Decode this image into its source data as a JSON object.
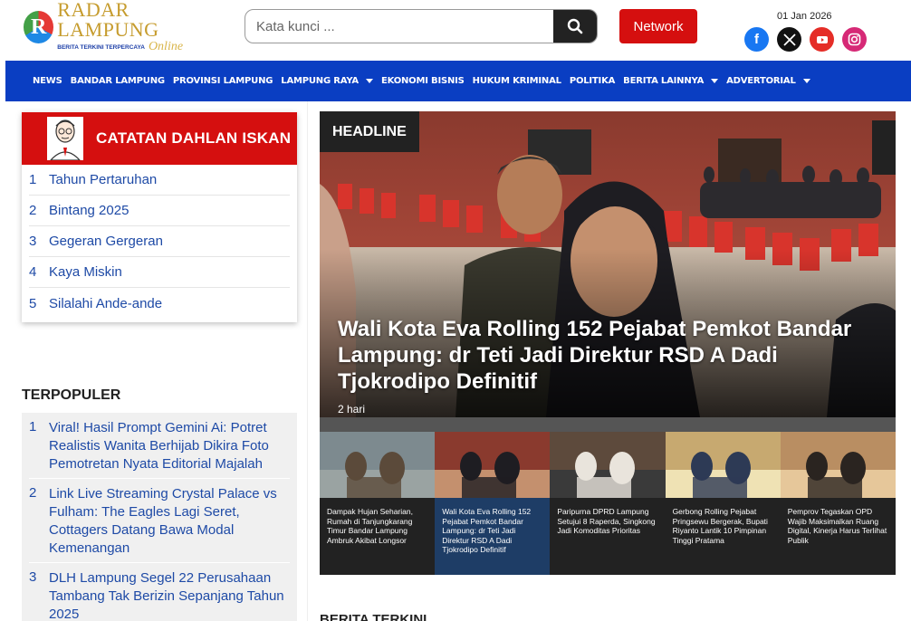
{
  "header": {
    "logo_letter": "R",
    "logo_title": "RADAR LAMPUNG",
    "logo_tagline": "BERITA TERKINI TERPERCAYA",
    "logo_online": "Online",
    "search_placeholder": "Kata kunci ...",
    "network_label": "Network",
    "date": "01 Jan 2026",
    "socials": [
      "facebook-icon",
      "x-icon",
      "youtube-icon",
      "instagram-icon"
    ]
  },
  "nav": {
    "items": [
      {
        "label": "NEWS",
        "dropdown": false
      },
      {
        "label": "BANDAR LAMPUNG",
        "dropdown": false
      },
      {
        "label": "PROVINSI LAMPUNG",
        "dropdown": false
      },
      {
        "label": "LAMPUNG RAYA",
        "dropdown": true
      },
      {
        "label": "EKONOMI BISNIS",
        "dropdown": false
      },
      {
        "label": "HUKUM KRIMINAL",
        "dropdown": false
      },
      {
        "label": "POLITIKA",
        "dropdown": false
      },
      {
        "label": "BERITA LAINNYA",
        "dropdown": true
      },
      {
        "label": "ADVERTORIAL",
        "dropdown": true
      }
    ]
  },
  "dahlan": {
    "title": "CATATAN DAHLAN ISKAN",
    "items": [
      {
        "num": "1",
        "label": "Tahun Pertaruhan"
      },
      {
        "num": "2",
        "label": "Bintang 2025"
      },
      {
        "num": "3",
        "label": "Gegeran Gergeran"
      },
      {
        "num": "4",
        "label": "Kaya Miskin"
      },
      {
        "num": "5",
        "label": "Silalahi Ande-ande"
      }
    ]
  },
  "terpopuler": {
    "title": "TERPOPULER",
    "items": [
      {
        "num": "1",
        "label": "Viral! Hasil Prompt Gemini Ai: Potret Realistis Wanita Berhijab Dikira Foto Pemotretan Nyata Editorial Majalah"
      },
      {
        "num": "2",
        "label": "Link Live Streaming Crystal Palace vs Fulham: The Eagles Lagi Seret, Cottagers Datang Bawa Modal Kemenangan"
      },
      {
        "num": "3",
        "label": "DLH Lampung Segel 22 Perusahaan Tambang Tak Berizin Sepanjang Tahun 2025"
      }
    ]
  },
  "headline": {
    "badge": "HEADLINE",
    "title": "Wali Kota Eva Rolling 152 Pejabat Pemkot Bandar Lampung: dr Teti Jadi Direktur RSD A Dadi Tjokrodipo Definitif",
    "time": "2 hari"
  },
  "thumbs": [
    {
      "caption": "Dampak Hujan Seharian, Rumah di Tanjungkarang Timur Bandar Lampung Ambruk Akibat Longsor",
      "active": false
    },
    {
      "caption": "Wali Kota Eva Rolling 152 Pejabat Pemkot Bandar Lampung: dr Teti Jadi Direktur RSD A Dadi Tjokrodipo Definitif",
      "active": true
    },
    {
      "caption": "Paripurna DPRD Lampung Setujui 8 Raperda, Singkong Jadi Komoditas Prioritas",
      "active": false
    },
    {
      "caption": "Gerbong Rolling Pejabat Pringsewu Bergerak, Bupati Riyanto Lantik 10 Pimpinan Tinggi Pratama",
      "active": false
    },
    {
      "caption": "Pemprov Tegaskan OPD Wajib Maksimalkan Ruang Digital, Kinerja Harus Terlihat Publik",
      "active": false
    }
  ],
  "terkini_title": "BERITA TERKINI"
}
